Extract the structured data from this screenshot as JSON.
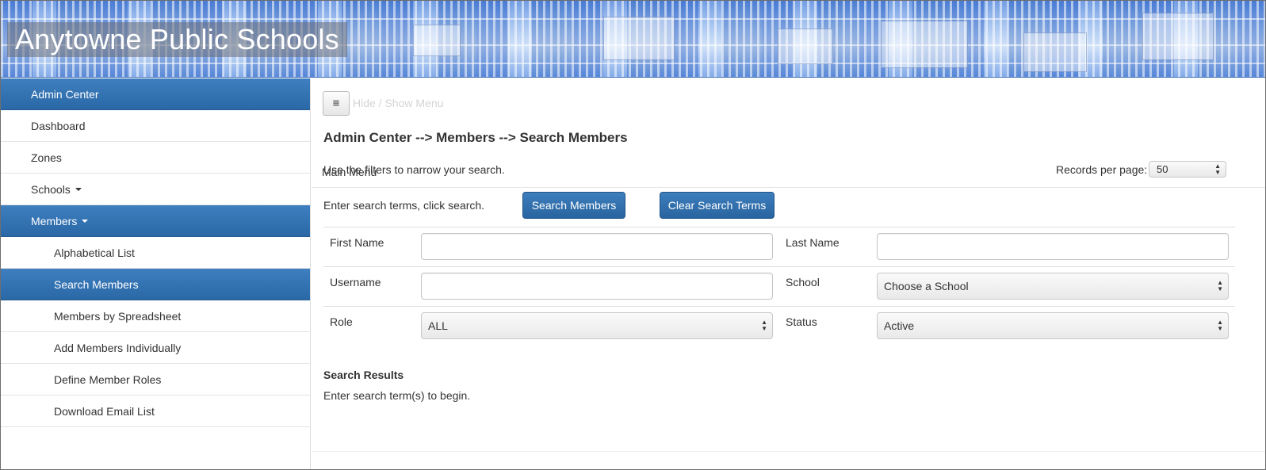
{
  "header": {
    "title": "Anytowne Public Schools"
  },
  "sidebar": {
    "items": [
      {
        "label": "Main Menu"
      },
      {
        "label": "Admin Center"
      },
      {
        "label": "Dashboard"
      },
      {
        "label": "Zones"
      },
      {
        "label": "Schools"
      },
      {
        "label": "Members"
      },
      {
        "label": "Alphabetical List"
      },
      {
        "label": "Search Members"
      },
      {
        "label": "Members by Spreadsheet"
      },
      {
        "label": "Add Members Individually"
      },
      {
        "label": "Define Member Roles"
      },
      {
        "label": "Download Email List"
      }
    ]
  },
  "main": {
    "menu_toggle": {
      "icon": "hamburger-icon",
      "glyph": "≡",
      "label": "Hide / Show Menu"
    },
    "breadcrumb": "Admin Center --> Members --> Search Members",
    "filter_hint": "Use the filters to narrow your search.",
    "records_per_page": {
      "label": "Records per page:",
      "value": "50"
    },
    "search_hint": "Enter search terms, click search.",
    "buttons": {
      "search": "Search Members",
      "clear": "Clear Search Terms"
    },
    "fields": {
      "first_name": {
        "label": "First Name",
        "value": ""
      },
      "last_name": {
        "label": "Last Name",
        "value": ""
      },
      "username": {
        "label": "Username",
        "value": ""
      },
      "school": {
        "label": "School",
        "value": "Choose a School"
      },
      "role": {
        "label": "Role",
        "value": "ALL"
      },
      "status": {
        "label": "Status",
        "value": "Active"
      }
    },
    "results": {
      "title": "Search Results",
      "message": "Enter search term(s) to begin."
    }
  },
  "colors": {
    "accent": "#2f6fae",
    "banner": "#6f9ee6"
  }
}
